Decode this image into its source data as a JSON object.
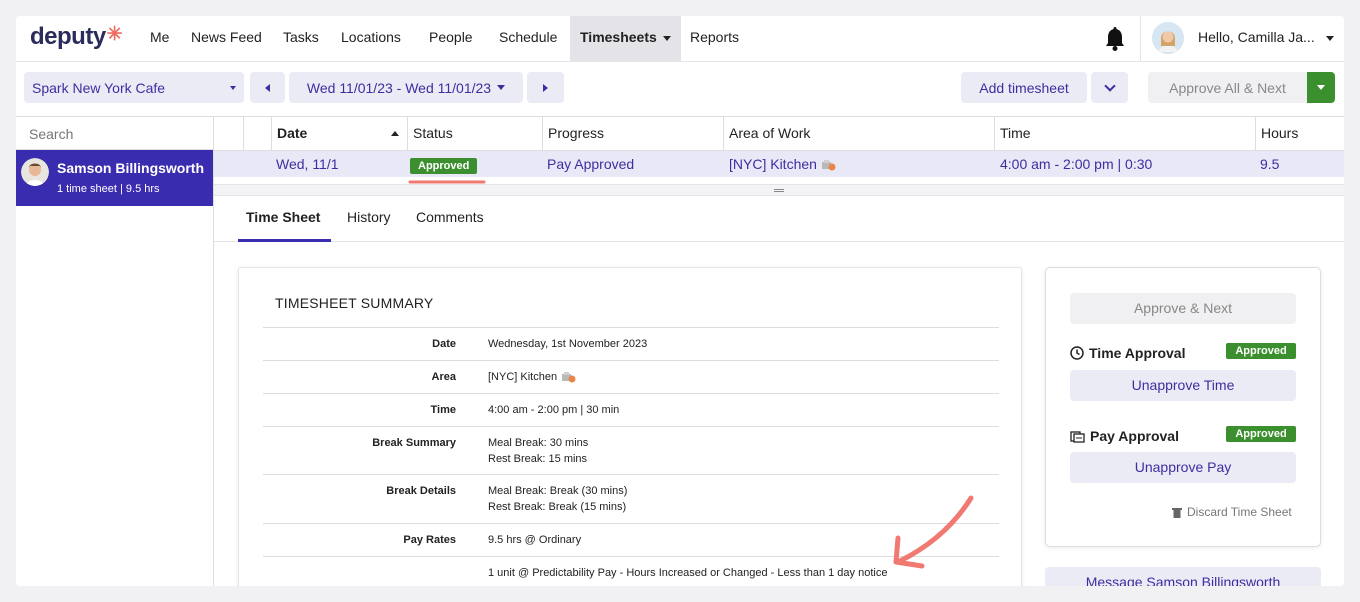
{
  "brand": {
    "name": "deputy",
    "accent": "#3a2cae",
    "logo_color": "#2b2b5c",
    "burst_color": "#ef6b5f"
  },
  "nav": {
    "items": [
      "Me",
      "News Feed",
      "Tasks",
      "Locations",
      "People",
      "Schedule",
      "Timesheets",
      "Reports"
    ],
    "active": "Timesheets",
    "notifications_icon": "bell-icon",
    "user_greeting": "Hello, Camilla Ja..."
  },
  "toolbar": {
    "location": "Spark New York Cafe",
    "date_range": "Wed 11/01/23 - Wed 11/01/23",
    "add_timesheet": "Add timesheet",
    "approve_all_next": "Approve All & Next"
  },
  "sidebar": {
    "search_placeholder": "Search",
    "employee": {
      "name": "Samson Billingsworth",
      "summary": "1 time sheet | 9.5 hrs"
    }
  },
  "table": {
    "columns": [
      "Date",
      "Status",
      "Progress",
      "Area of Work",
      "Time",
      "Hours"
    ],
    "rows": [
      {
        "date": "Wed, 11/1",
        "status": "Approved",
        "progress": "Pay Approved",
        "area": "[NYC] Kitchen",
        "time": "4:00 am - 2:00 pm | 0:30",
        "hours": "9.5"
      }
    ]
  },
  "tabs": {
    "items": [
      "Time Sheet",
      "History",
      "Comments"
    ],
    "active": "Time Sheet"
  },
  "summary": {
    "title": "TIMESHEET SUMMARY",
    "rows": [
      {
        "label": "Date",
        "lines": [
          "Wednesday, 1st November 2023"
        ]
      },
      {
        "label": "Area",
        "lines": [
          "[NYC] Kitchen"
        ]
      },
      {
        "label": "Time",
        "lines": [
          "4:00 am - 2:00 pm | 30 min"
        ]
      },
      {
        "label": "Break Summary",
        "lines": [
          "Meal Break: 30 mins",
          "Rest Break: 15 mins"
        ]
      },
      {
        "label": "Break Details",
        "lines": [
          "Meal Break: Break (30 mins)",
          "Rest Break: Break (15 mins)"
        ]
      },
      {
        "label": "Pay Rates",
        "lines": [
          "9.5 hrs @ Ordinary"
        ]
      },
      {
        "label": "",
        "lines": [
          "1 unit @ Predictability Pay - Hours Increased or Changed - Less than 1 day notice"
        ]
      }
    ]
  },
  "approval": {
    "approve_next": "Approve & Next",
    "time_approval": {
      "label": "Time Approval",
      "status": "Approved",
      "action": "Unapprove Time"
    },
    "pay_approval": {
      "label": "Pay Approval",
      "status": "Approved",
      "action": "Unapprove Pay"
    },
    "discard": "Discard Time Sheet",
    "message": "Message Samson Billingsworth"
  },
  "colors": {
    "approved_green": "#3c8f2e",
    "annotation": "#f07a72",
    "selected_row": "#e9e8f7"
  }
}
